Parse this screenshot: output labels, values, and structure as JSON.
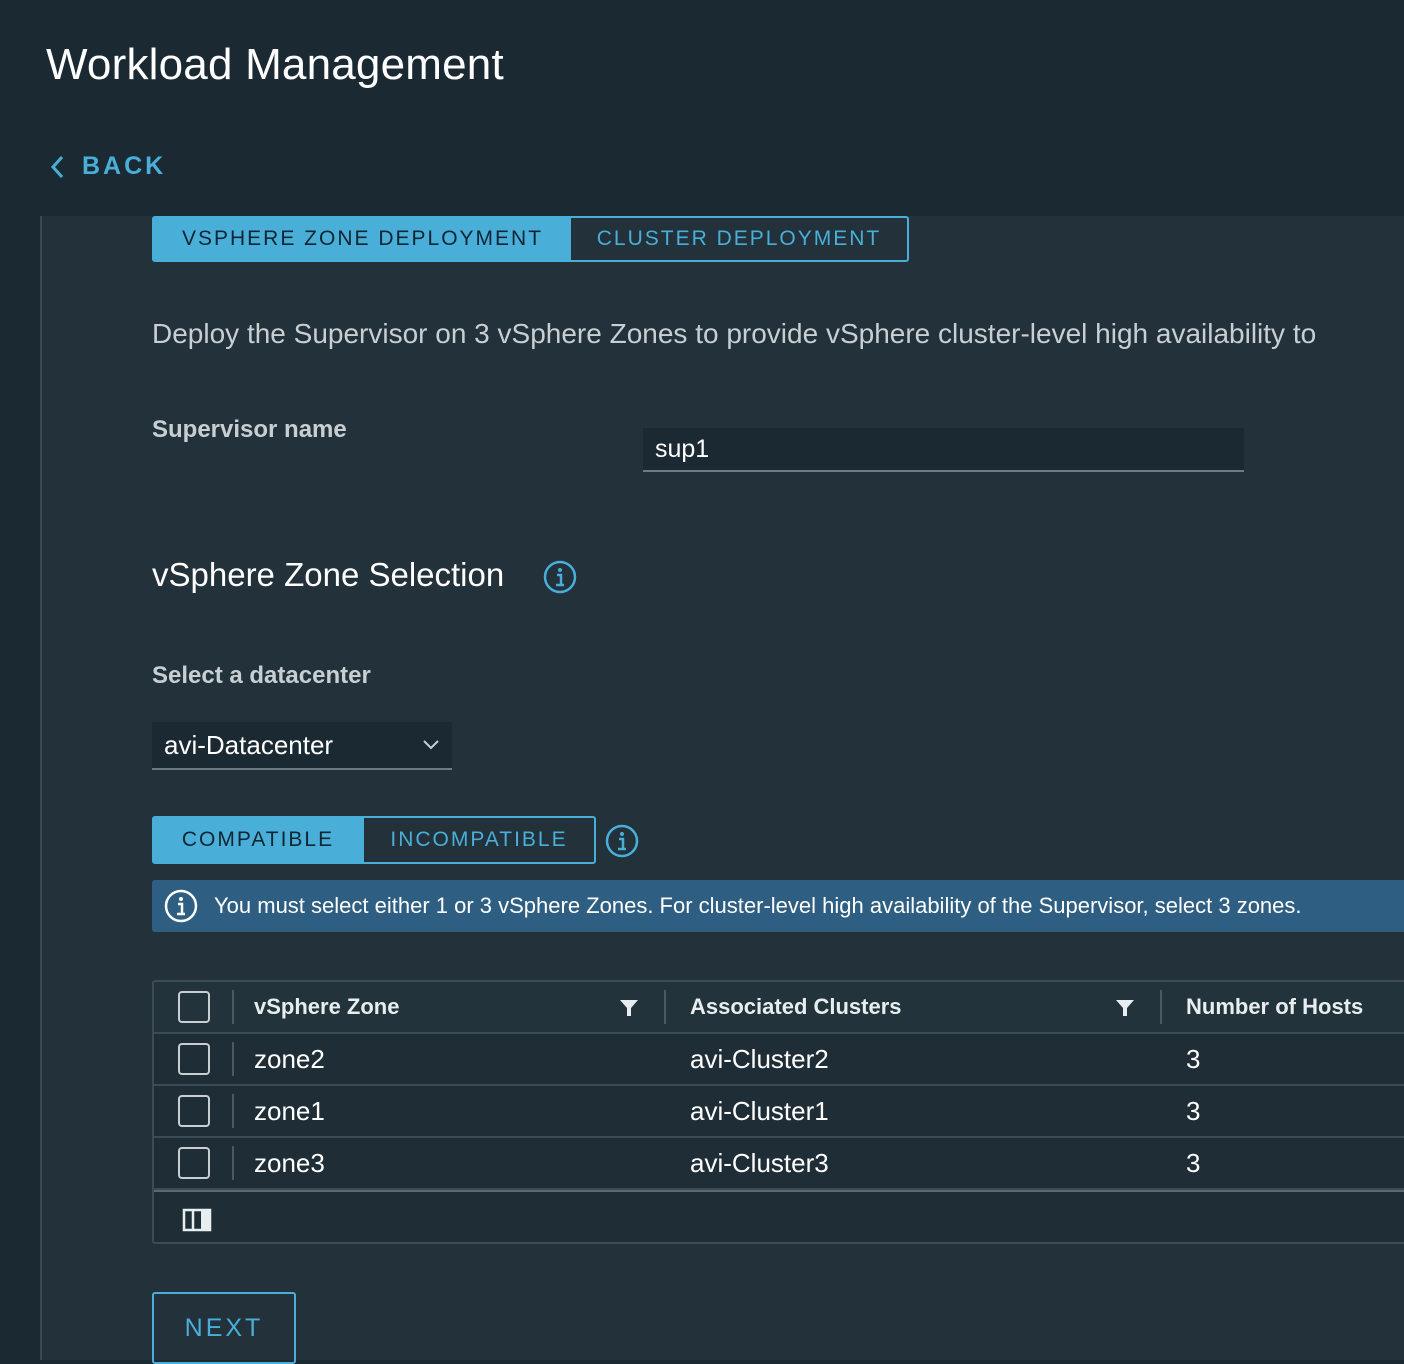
{
  "header": {
    "title": "Workload Management",
    "back_label": "BACK"
  },
  "deployment_tabs": {
    "zone_label": "VSPHERE ZONE DEPLOYMENT",
    "cluster_label": "CLUSTER DEPLOYMENT",
    "active": "zone"
  },
  "intro_text": "Deploy the Supervisor on 3 vSphere Zones to provide vSphere cluster-level high availability to",
  "supervisor_name": {
    "label": "Supervisor name",
    "value": "sup1"
  },
  "zone_selection": {
    "title": "vSphere Zone Selection",
    "datacenter_label": "Select a datacenter",
    "datacenter_value": "avi-Datacenter"
  },
  "compat_tabs": {
    "compatible_label": "COMPATIBLE",
    "incompatible_label": "INCOMPATIBLE",
    "active": "compatible"
  },
  "alert": {
    "text": "You must select either 1 or 3 vSphere Zones. For cluster-level high availability of the Supervisor, select 3 zones."
  },
  "table": {
    "columns": [
      "vSphere Zone",
      "Associated Clusters",
      "Number of Hosts"
    ],
    "rows": [
      {
        "zone": "zone2",
        "cluster": "avi-Cluster2",
        "hosts": "3"
      },
      {
        "zone": "zone1",
        "cluster": "avi-Cluster1",
        "hosts": "3"
      },
      {
        "zone": "zone3",
        "cluster": "avi-Cluster3",
        "hosts": "3"
      }
    ]
  },
  "next_label": "NEXT",
  "colors": {
    "accent": "#49afd9",
    "background": "#1b2a32",
    "panel": "#22313a",
    "alert": "#2e5f82"
  }
}
